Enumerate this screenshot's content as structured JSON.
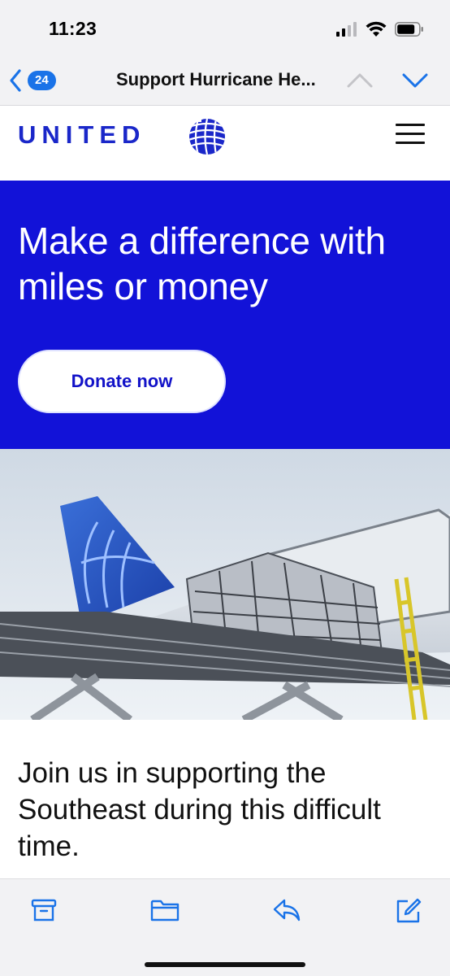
{
  "status_bar": {
    "time": "11:23",
    "icons": [
      "signal-icon",
      "wifi-icon",
      "battery-icon"
    ]
  },
  "mail_header": {
    "unread_count": "24",
    "subject": "Support Hurricane He...",
    "icons": [
      "chevron-left-icon",
      "chevron-up-icon",
      "chevron-down-icon"
    ]
  },
  "brand": {
    "wordmark": "UNITED",
    "color": "#1a27c9",
    "icons": [
      "globe-logo",
      "hamburger-menu-icon"
    ]
  },
  "hero": {
    "headline": "Make a difference with miles or money",
    "cta_label": "Donate now",
    "background_color": "#1212d8"
  },
  "body": {
    "paragraph": "Join us in supporting the Southeast during this difficult time."
  },
  "toolbar": {
    "icons": [
      "archive-icon",
      "folder-icon",
      "reply-icon",
      "compose-icon"
    ],
    "accent_color": "#1a73e8"
  }
}
